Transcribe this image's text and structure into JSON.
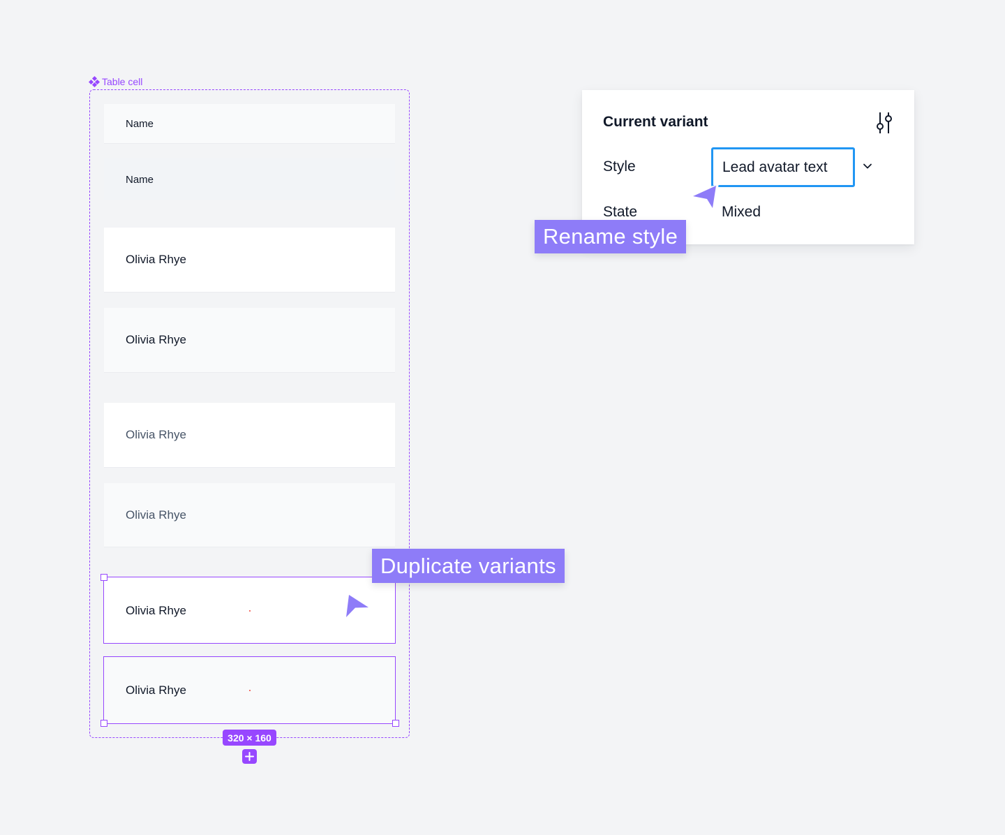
{
  "component_set": {
    "label": "Table cell",
    "icon": "component-set-icon",
    "rows": [
      {
        "text": "Name",
        "variant": "header"
      },
      {
        "text": "Name",
        "variant": "header-alt"
      },
      {
        "text": "Olivia Rhye",
        "variant": "lead-avatar-text",
        "state": "default"
      },
      {
        "text": "Olivia Rhye",
        "variant": "lead-avatar-text",
        "state": "alt"
      },
      {
        "text": "Olivia Rhye",
        "variant": "text",
        "state": "default"
      },
      {
        "text": "Olivia Rhye",
        "variant": "text",
        "state": "alt"
      },
      {
        "text": "Olivia Rhye",
        "variant": "duplicate",
        "state": "selected"
      },
      {
        "text": "Olivia Rhye",
        "variant": "duplicate",
        "state": "selected"
      }
    ],
    "selection_size": "320 × 160",
    "add_icon": "plus-icon"
  },
  "callouts": {
    "duplicate": "Duplicate variants",
    "rename": "Rename style"
  },
  "variant_panel": {
    "title": "Current variant",
    "settings_icon": "sliders-icon",
    "properties": [
      {
        "label": "Style",
        "value": "Lead avatar text",
        "control": "dropdown",
        "editing": true
      },
      {
        "label": "State",
        "value": "Mixed",
        "control": "text"
      }
    ]
  },
  "colors": {
    "accent": "#9747ff",
    "callout": "#8e7cf8",
    "focus": "#2196f3",
    "canvas": "#f3f4f6"
  }
}
